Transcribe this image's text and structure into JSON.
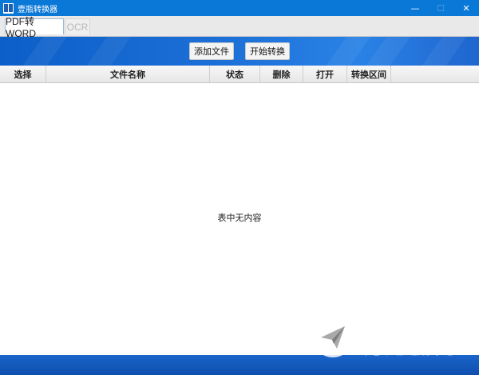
{
  "window": {
    "title": "壹瓶转换器",
    "minimize": "—",
    "maximize": "☐",
    "close": "✕"
  },
  "tabs": [
    {
      "label": "PDF转WORD",
      "active": true
    },
    {
      "label": "OCR",
      "active": false
    }
  ],
  "toolbar": {
    "add_file": "添加文件",
    "start_convert": "开始转换"
  },
  "table": {
    "headers": [
      "选择",
      "文件名称",
      "状态",
      "删除",
      "打开",
      "转换区间"
    ],
    "empty_text": "表中无内容"
  },
  "watermark": {
    "brand": "统一下载站",
    "tagline": "绿色下载 服务承诺"
  },
  "colors": {
    "titlebar": "#0a78d7",
    "banner": "#1b6fd6",
    "bottombar": "#1b64c9"
  }
}
